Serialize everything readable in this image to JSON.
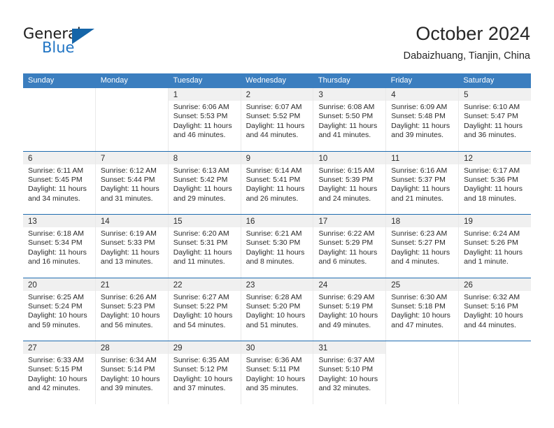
{
  "brand": {
    "name_part1": "General",
    "name_part2": "Blue",
    "accent_color": "#2175c4",
    "triangle_color": "#1565a8"
  },
  "header": {
    "title": "October 2024",
    "subtitle": "Dabaizhuang, Tianjin, China"
  },
  "theme": {
    "header_blue": "#3b7ebf",
    "row_line_blue": "#1f6cb0",
    "daynum_band": "#f0f0f0"
  },
  "weekdays": [
    "Sunday",
    "Monday",
    "Tuesday",
    "Wednesday",
    "Thursday",
    "Friday",
    "Saturday"
  ],
  "labels": {
    "sunrise": "Sunrise:",
    "sunset": "Sunset:",
    "daylight": "Daylight:"
  },
  "weeks": [
    [
      {
        "day": "",
        "sunrise": "",
        "sunset": "",
        "daylight_line1": "",
        "daylight_line2": ""
      },
      {
        "day": "",
        "sunrise": "",
        "sunset": "",
        "daylight_line1": "",
        "daylight_line2": ""
      },
      {
        "day": "1",
        "sunrise": "Sunrise: 6:06 AM",
        "sunset": "Sunset: 5:53 PM",
        "daylight_line1": "Daylight: 11 hours",
        "daylight_line2": "and 46 minutes."
      },
      {
        "day": "2",
        "sunrise": "Sunrise: 6:07 AM",
        "sunset": "Sunset: 5:52 PM",
        "daylight_line1": "Daylight: 11 hours",
        "daylight_line2": "and 44 minutes."
      },
      {
        "day": "3",
        "sunrise": "Sunrise: 6:08 AM",
        "sunset": "Sunset: 5:50 PM",
        "daylight_line1": "Daylight: 11 hours",
        "daylight_line2": "and 41 minutes."
      },
      {
        "day": "4",
        "sunrise": "Sunrise: 6:09 AM",
        "sunset": "Sunset: 5:48 PM",
        "daylight_line1": "Daylight: 11 hours",
        "daylight_line2": "and 39 minutes."
      },
      {
        "day": "5",
        "sunrise": "Sunrise: 6:10 AM",
        "sunset": "Sunset: 5:47 PM",
        "daylight_line1": "Daylight: 11 hours",
        "daylight_line2": "and 36 minutes."
      }
    ],
    [
      {
        "day": "6",
        "sunrise": "Sunrise: 6:11 AM",
        "sunset": "Sunset: 5:45 PM",
        "daylight_line1": "Daylight: 11 hours",
        "daylight_line2": "and 34 minutes."
      },
      {
        "day": "7",
        "sunrise": "Sunrise: 6:12 AM",
        "sunset": "Sunset: 5:44 PM",
        "daylight_line1": "Daylight: 11 hours",
        "daylight_line2": "and 31 minutes."
      },
      {
        "day": "8",
        "sunrise": "Sunrise: 6:13 AM",
        "sunset": "Sunset: 5:42 PM",
        "daylight_line1": "Daylight: 11 hours",
        "daylight_line2": "and 29 minutes."
      },
      {
        "day": "9",
        "sunrise": "Sunrise: 6:14 AM",
        "sunset": "Sunset: 5:41 PM",
        "daylight_line1": "Daylight: 11 hours",
        "daylight_line2": "and 26 minutes."
      },
      {
        "day": "10",
        "sunrise": "Sunrise: 6:15 AM",
        "sunset": "Sunset: 5:39 PM",
        "daylight_line1": "Daylight: 11 hours",
        "daylight_line2": "and 24 minutes."
      },
      {
        "day": "11",
        "sunrise": "Sunrise: 6:16 AM",
        "sunset": "Sunset: 5:37 PM",
        "daylight_line1": "Daylight: 11 hours",
        "daylight_line2": "and 21 minutes."
      },
      {
        "day": "12",
        "sunrise": "Sunrise: 6:17 AM",
        "sunset": "Sunset: 5:36 PM",
        "daylight_line1": "Daylight: 11 hours",
        "daylight_line2": "and 18 minutes."
      }
    ],
    [
      {
        "day": "13",
        "sunrise": "Sunrise: 6:18 AM",
        "sunset": "Sunset: 5:34 PM",
        "daylight_line1": "Daylight: 11 hours",
        "daylight_line2": "and 16 minutes."
      },
      {
        "day": "14",
        "sunrise": "Sunrise: 6:19 AM",
        "sunset": "Sunset: 5:33 PM",
        "daylight_line1": "Daylight: 11 hours",
        "daylight_line2": "and 13 minutes."
      },
      {
        "day": "15",
        "sunrise": "Sunrise: 6:20 AM",
        "sunset": "Sunset: 5:31 PM",
        "daylight_line1": "Daylight: 11 hours",
        "daylight_line2": "and 11 minutes."
      },
      {
        "day": "16",
        "sunrise": "Sunrise: 6:21 AM",
        "sunset": "Sunset: 5:30 PM",
        "daylight_line1": "Daylight: 11 hours",
        "daylight_line2": "and 8 minutes."
      },
      {
        "day": "17",
        "sunrise": "Sunrise: 6:22 AM",
        "sunset": "Sunset: 5:29 PM",
        "daylight_line1": "Daylight: 11 hours",
        "daylight_line2": "and 6 minutes."
      },
      {
        "day": "18",
        "sunrise": "Sunrise: 6:23 AM",
        "sunset": "Sunset: 5:27 PM",
        "daylight_line1": "Daylight: 11 hours",
        "daylight_line2": "and 4 minutes."
      },
      {
        "day": "19",
        "sunrise": "Sunrise: 6:24 AM",
        "sunset": "Sunset: 5:26 PM",
        "daylight_line1": "Daylight: 11 hours",
        "daylight_line2": "and 1 minute."
      }
    ],
    [
      {
        "day": "20",
        "sunrise": "Sunrise: 6:25 AM",
        "sunset": "Sunset: 5:24 PM",
        "daylight_line1": "Daylight: 10 hours",
        "daylight_line2": "and 59 minutes."
      },
      {
        "day": "21",
        "sunrise": "Sunrise: 6:26 AM",
        "sunset": "Sunset: 5:23 PM",
        "daylight_line1": "Daylight: 10 hours",
        "daylight_line2": "and 56 minutes."
      },
      {
        "day": "22",
        "sunrise": "Sunrise: 6:27 AM",
        "sunset": "Sunset: 5:22 PM",
        "daylight_line1": "Daylight: 10 hours",
        "daylight_line2": "and 54 minutes."
      },
      {
        "day": "23",
        "sunrise": "Sunrise: 6:28 AM",
        "sunset": "Sunset: 5:20 PM",
        "daylight_line1": "Daylight: 10 hours",
        "daylight_line2": "and 51 minutes."
      },
      {
        "day": "24",
        "sunrise": "Sunrise: 6:29 AM",
        "sunset": "Sunset: 5:19 PM",
        "daylight_line1": "Daylight: 10 hours",
        "daylight_line2": "and 49 minutes."
      },
      {
        "day": "25",
        "sunrise": "Sunrise: 6:30 AM",
        "sunset": "Sunset: 5:18 PM",
        "daylight_line1": "Daylight: 10 hours",
        "daylight_line2": "and 47 minutes."
      },
      {
        "day": "26",
        "sunrise": "Sunrise: 6:32 AM",
        "sunset": "Sunset: 5:16 PM",
        "daylight_line1": "Daylight: 10 hours",
        "daylight_line2": "and 44 minutes."
      }
    ],
    [
      {
        "day": "27",
        "sunrise": "Sunrise: 6:33 AM",
        "sunset": "Sunset: 5:15 PM",
        "daylight_line1": "Daylight: 10 hours",
        "daylight_line2": "and 42 minutes."
      },
      {
        "day": "28",
        "sunrise": "Sunrise: 6:34 AM",
        "sunset": "Sunset: 5:14 PM",
        "daylight_line1": "Daylight: 10 hours",
        "daylight_line2": "and 39 minutes."
      },
      {
        "day": "29",
        "sunrise": "Sunrise: 6:35 AM",
        "sunset": "Sunset: 5:12 PM",
        "daylight_line1": "Daylight: 10 hours",
        "daylight_line2": "and 37 minutes."
      },
      {
        "day": "30",
        "sunrise": "Sunrise: 6:36 AM",
        "sunset": "Sunset: 5:11 PM",
        "daylight_line1": "Daylight: 10 hours",
        "daylight_line2": "and 35 minutes."
      },
      {
        "day": "31",
        "sunrise": "Sunrise: 6:37 AM",
        "sunset": "Sunset: 5:10 PM",
        "daylight_line1": "Daylight: 10 hours",
        "daylight_line2": "and 32 minutes."
      },
      {
        "day": "",
        "sunrise": "",
        "sunset": "",
        "daylight_line1": "",
        "daylight_line2": ""
      },
      {
        "day": "",
        "sunrise": "",
        "sunset": "",
        "daylight_line1": "",
        "daylight_line2": ""
      }
    ]
  ]
}
